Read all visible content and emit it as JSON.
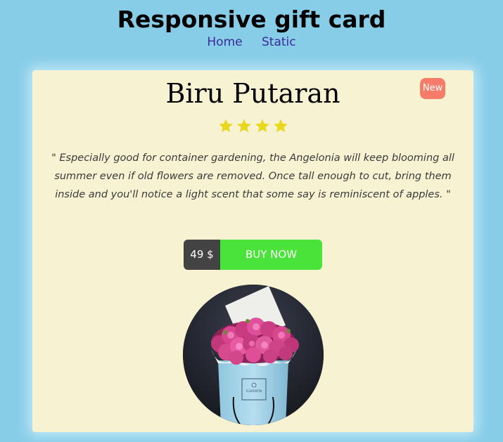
{
  "header": {
    "title": "Responsive gift card",
    "nav": [
      {
        "label": "Home"
      },
      {
        "label": "Static"
      }
    ]
  },
  "card": {
    "product_name": "Biru Putaran",
    "badge": "New",
    "rating": 4,
    "rating_max": 4,
    "description": "\" Especially good for container gardening, the Angelonia will keep blooming all summer even if old flowers are removed. Once tall enough to cut, bring them inside and you'll notice a light scent that some say is reminiscent of apples. \"",
    "price": "49 $",
    "buy_label": "BUY NOW",
    "image": {
      "subject": "flower-box-photo",
      "box_brand": "FLORENTIN"
    }
  },
  "colors": {
    "background": "#87cde8",
    "card": "#f7f2d2",
    "badge": "#f47c69",
    "star": "#e8d81c",
    "price_bg": "#434343",
    "buy_bg": "#4ae33a",
    "nav_link": "#3b2a9a"
  },
  "icons": {
    "star": "star-icon"
  }
}
